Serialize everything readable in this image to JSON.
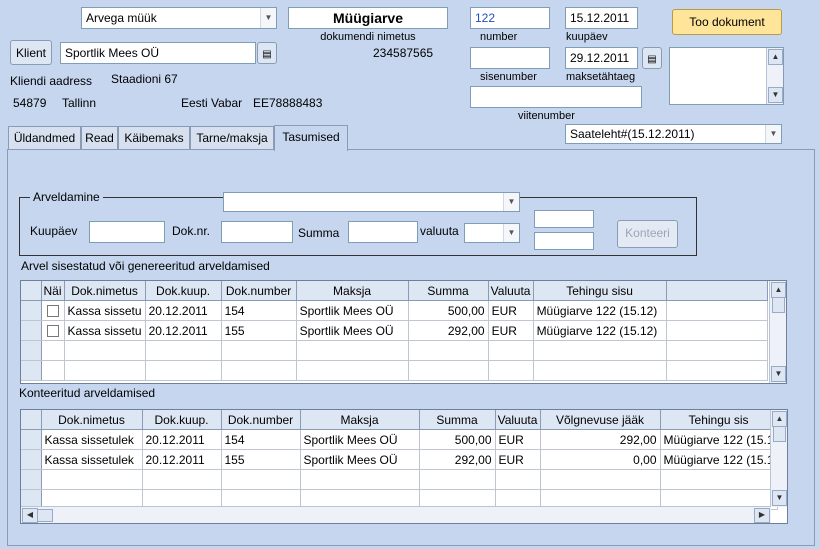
{
  "header": {
    "doc_type_select": "Arvega müük",
    "doc_title": "Müügiarve",
    "doc_title_caption": "dokumendi nimetus",
    "doc_code": "234587565",
    "number_value": "122",
    "number_label": "number",
    "date_value": "15.12.2011",
    "date_label": "kuupäev",
    "internal_number_value": "",
    "internal_number_label": "sisenumber",
    "due_date_value": "29.12.2011",
    "due_date_label": "maksetähtaeg",
    "reference_value": "",
    "reference_label": "viitenumber",
    "fetch_button": "Too dokument",
    "notes_value": "",
    "client_button": "Klient",
    "client_value": "Sportlik Mees OÜ",
    "address_label": "Kliendi aadress",
    "address_street": "Staadioni 67",
    "postcode": "54879",
    "city": "Tallinn",
    "bank": "Eesti Vabar",
    "iban": "EE78888483",
    "waybill_select": "Saateleht#(15.12.2011)"
  },
  "tabs": [
    {
      "label": "Üldandmed"
    },
    {
      "label": "Read"
    },
    {
      "label": "Käibemaks"
    },
    {
      "label": "Tarne/maksja"
    },
    {
      "label": "Tasumised"
    }
  ],
  "settlement": {
    "legend": "Arveldamine",
    "combo_value": "",
    "date_label": "Kuupäev",
    "date_value": "",
    "docnr_label": "Dok.nr.",
    "docnr_value": "",
    "sum_label": "Summa",
    "sum_value": "",
    "currency_label": "valuuta",
    "currency_value": "",
    "extra_top": "",
    "extra_bottom": "",
    "confirm_button": "Konteeri"
  },
  "grid1": {
    "caption": "Arvel sisestatud või genereeritud arveldamised",
    "columns": [
      "Näi",
      "Dok.nimetus",
      "Dok.kuup.",
      "Dok.number",
      "Maksja",
      "Summa",
      "Valuuta",
      "Tehingu sisu"
    ],
    "rows": [
      [
        "",
        "Kassa sissetu",
        "20.12.2011",
        "154",
        "Sportlik Mees OÜ",
        "500,00",
        "EUR",
        "Müügiarve 122 (15.12)"
      ],
      [
        "",
        "Kassa sissetu",
        "20.12.2011",
        "155",
        "Sportlik Mees OÜ",
        "292,00",
        "EUR",
        "Müügiarve 122 (15.12)"
      ]
    ]
  },
  "grid2": {
    "caption": "Konteeritud arveldamised",
    "columns": [
      "Dok.nimetus",
      "Dok.kuup.",
      "Dok.number",
      "Maksja",
      "Summa",
      "Valuuta",
      "Võlgnevuse jääk",
      "Tehingu sis"
    ],
    "rows": [
      [
        "Kassa sissetulek",
        "20.12.2011",
        "154",
        "Sportlik Mees OÜ",
        "500,00",
        "EUR",
        "292,00",
        "Müügiarve 122 (15.1"
      ],
      [
        "Kassa sissetulek",
        "20.12.2011",
        "155",
        "Sportlik Mees OÜ",
        "292,00",
        "EUR",
        "0,00",
        "Müügiarve 122 (15.1"
      ]
    ]
  }
}
